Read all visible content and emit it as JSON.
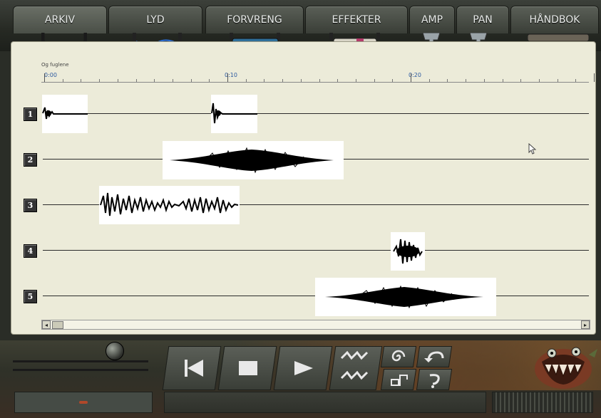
{
  "tabs": [
    {
      "label": "ARKIV",
      "active": true
    },
    {
      "label": "LYD",
      "active": false
    },
    {
      "label": "FORVRENG",
      "active": false
    },
    {
      "label": "EFFEKTER",
      "active": false
    },
    {
      "label": "AMP",
      "active": false
    },
    {
      "label": "PAN",
      "active": false
    },
    {
      "label": "HÅNDBOK",
      "active": false
    }
  ],
  "track_title": "Og fuglene",
  "ruler": {
    "labels": [
      "0:00",
      "0:10",
      "0:20"
    ]
  },
  "tracks": [
    {
      "number": "1"
    },
    {
      "number": "2"
    },
    {
      "number": "3"
    },
    {
      "number": "4"
    },
    {
      "number": "5"
    }
  ],
  "scrollbar": {
    "left_arrow": "◂",
    "right_arrow": "▸"
  },
  "colors": {
    "panel_bg": "#ecebd9",
    "ruler_label": "#2d5aa0",
    "clip_bg": "#ffffff",
    "waveform": "#000000"
  },
  "controls": {
    "icons": [
      "rewind-icon",
      "stop-icon",
      "play-icon",
      "zigzag-icon",
      "spiral-icon",
      "undo-icon",
      "shape-icon",
      "redo-icon"
    ]
  }
}
